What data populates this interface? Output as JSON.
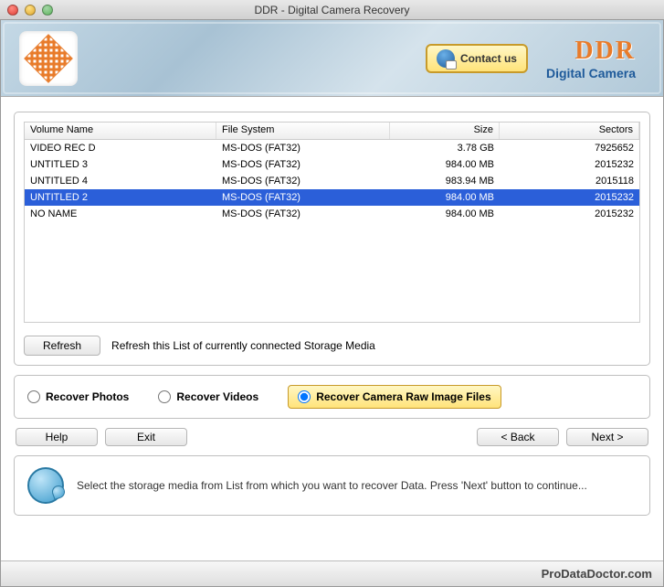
{
  "window": {
    "title": "DDR - Digital Camera Recovery"
  },
  "header": {
    "contact_label": "Contact us",
    "brand": "DDR",
    "brand_sub": "Digital Camera"
  },
  "table": {
    "columns": {
      "name": "Volume Name",
      "fs": "File System",
      "size": "Size",
      "sectors": "Sectors"
    },
    "rows": [
      {
        "name": "VIDEO REC D",
        "fs": "MS-DOS (FAT32)",
        "size": "3.78  GB",
        "sectors": "7925652",
        "selected": false
      },
      {
        "name": "UNTITLED 3",
        "fs": "MS-DOS (FAT32)",
        "size": "984.00  MB",
        "sectors": "2015232",
        "selected": false
      },
      {
        "name": "UNTITLED 4",
        "fs": "MS-DOS (FAT32)",
        "size": "983.94  MB",
        "sectors": "2015118",
        "selected": false
      },
      {
        "name": "UNTITLED 2",
        "fs": "MS-DOS (FAT32)",
        "size": "984.00  MB",
        "sectors": "2015232",
        "selected": true
      },
      {
        "name": "NO NAME",
        "fs": "MS-DOS (FAT32)",
        "size": "984.00  MB",
        "sectors": "2015232",
        "selected": false
      }
    ]
  },
  "refresh": {
    "button": "Refresh",
    "text": "Refresh this List of currently connected Storage Media"
  },
  "radios": {
    "photos": "Recover Photos",
    "videos": "Recover Videos",
    "raw": "Recover Camera Raw Image Files",
    "selected": "raw"
  },
  "nav": {
    "help": "Help",
    "exit": "Exit",
    "back": "< Back",
    "next": "Next >"
  },
  "info": {
    "text": "Select the storage media from List from which you want to recover Data. Press 'Next' button to continue..."
  },
  "footer": {
    "text": "ProDataDoctor.com"
  }
}
